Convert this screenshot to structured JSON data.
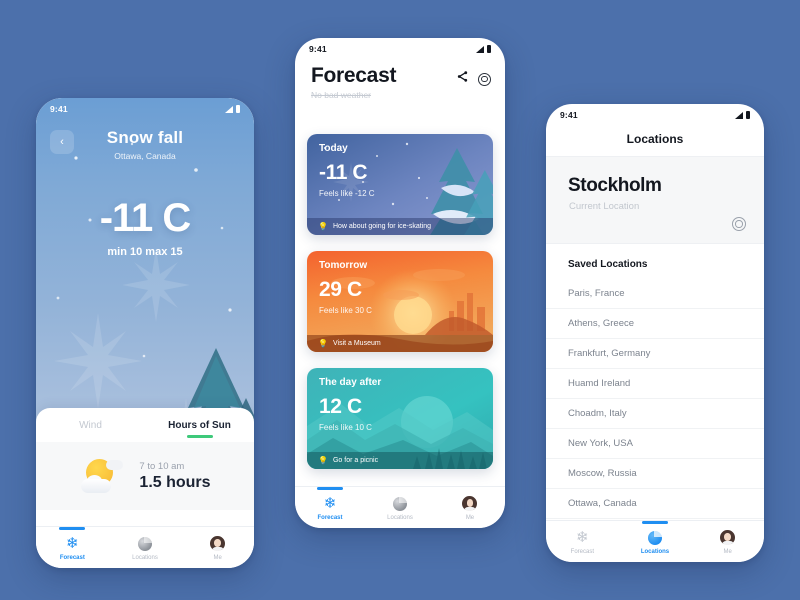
{
  "background_color": "#4c70ab",
  "accent_color": "#1f8ef1",
  "phone_detail": {
    "status": {
      "time": "9:41"
    },
    "back_label": "‹",
    "title": "Snow fall",
    "location": "Ottawa, Canada",
    "temperature": "-11 C",
    "min_max": "min 10  max 15",
    "tabs": [
      {
        "label": "Wind",
        "active": false
      },
      {
        "label": "Hours of Sun",
        "active": true
      }
    ],
    "sun_panel": {
      "icon": "sun-behind-cloud-icon",
      "time_range": "7 to 10 am",
      "duration": "1.5 hours"
    },
    "nav": [
      {
        "label": "Forecast",
        "icon": "snowflake-icon",
        "active": true
      },
      {
        "label": "Locations",
        "icon": "globe-icon",
        "active": false
      },
      {
        "label": "Me",
        "icon": "avatar-icon",
        "active": false
      }
    ]
  },
  "phone_forecast": {
    "status": {
      "time": "9:41"
    },
    "title": "Forecast",
    "subtitle": "No bad weather",
    "actions": [
      {
        "name": "share-icon",
        "label": "share"
      },
      {
        "name": "target-icon",
        "label": "locate"
      }
    ],
    "cards": [
      {
        "day": "Today",
        "temp": "-11 C",
        "feels": "Feels like -12 C",
        "tip": "How about going for ice-skating",
        "theme": "winter"
      },
      {
        "day": "Tomorrow",
        "temp": "29 C",
        "feels": "Feels like 30 C",
        "tip": "Visit a Museum",
        "theme": "desert"
      },
      {
        "day": "The day after",
        "temp": "12 C",
        "feels": "Feels like 10 C",
        "tip": "Go for a picnic",
        "theme": "mountain"
      }
    ],
    "nav": [
      {
        "label": "Forecast",
        "icon": "snowflake-icon",
        "active": true
      },
      {
        "label": "Locations",
        "icon": "globe-icon",
        "active": false
      },
      {
        "label": "Me",
        "icon": "avatar-icon",
        "active": false
      }
    ]
  },
  "phone_locations": {
    "status": {
      "time": "9:41"
    },
    "title": "Locations",
    "current": {
      "city": "Stockholm",
      "subtitle": "Current Location",
      "icon": "target-icon"
    },
    "saved_header": "Saved Locations",
    "saved": [
      "Paris, France",
      "Athens, Greece",
      "Frankfurt, Germany",
      "Huamd Ireland",
      "Choadm, Italy",
      "New York, USA",
      "Moscow, Russia",
      "Ottawa, Canada"
    ],
    "nav": [
      {
        "label": "Forecast",
        "icon": "snowflake-icon",
        "active": false
      },
      {
        "label": "Locations",
        "icon": "globe-icon",
        "active": true
      },
      {
        "label": "Me",
        "icon": "avatar-icon",
        "active": false
      }
    ]
  }
}
